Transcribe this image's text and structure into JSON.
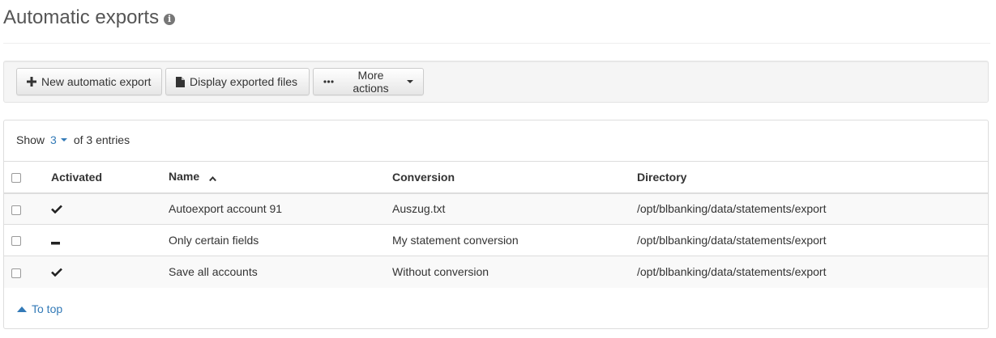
{
  "page": {
    "title": "Automatic exports",
    "info_icon": "info-circle-icon"
  },
  "toolbar": {
    "new_export_label": "New automatic export",
    "display_files_label": "Display exported files",
    "more_actions_label": "More actions"
  },
  "list": {
    "show_label": "Show",
    "show_count": "3",
    "show_suffix": "of 3 entries",
    "columns": {
      "activated": "Activated",
      "name": "Name",
      "conversion": "Conversion",
      "directory": "Directory"
    },
    "sort": {
      "column": "name",
      "direction": "ascending"
    },
    "rows": [
      {
        "activated": true,
        "name": "Autoexport account 91",
        "conversion": "Auszug.txt",
        "directory": "/opt/blbanking/data/statements/export"
      },
      {
        "activated": false,
        "name": "Only certain fields",
        "conversion": "My statement conversion",
        "directory": "/opt/blbanking/data/statements/export"
      },
      {
        "activated": true,
        "name": "Save all accounts",
        "conversion": "Without conversion",
        "directory": "/opt/blbanking/data/statements/export"
      }
    ],
    "to_top_label": "To top"
  },
  "colors": {
    "link": "#337ab7",
    "toolbar_bg": "#f5f5f5",
    "stripe": "#f9f9f9",
    "border": "#dddddd"
  }
}
